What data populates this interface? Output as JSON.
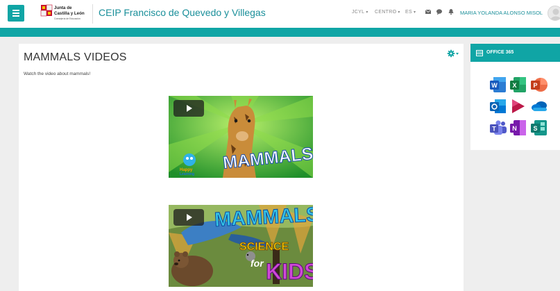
{
  "header": {
    "site_title": "CEIP Francisco de Quevedo y Villegas",
    "logo_line1": "Junta de",
    "logo_line2": "Castilla y León",
    "logo_line3": "Consejería de Educación",
    "nav": [
      {
        "label": "JCYL",
        "caret": "▾"
      },
      {
        "label": "CENTRO",
        "caret": "▾"
      },
      {
        "label": "ES",
        "caret": "▾"
      }
    ],
    "username": "MARIA YOLANDA ALONSO MISOL"
  },
  "main": {
    "title": "MAMMALS VIDEOS",
    "description": "Watch the video about mammals!",
    "videos": [
      {
        "thumb_text": "MAMMALS",
        "brand_line1": "Happy",
        "brand_line2": "Learning"
      },
      {
        "thumb_line1": "MAMMALS",
        "thumb_line2": "SCIENCE",
        "thumb_line3": "for",
        "thumb_line4": "KIDS"
      }
    ]
  },
  "sidebar_block": {
    "title": "OFFICE 365",
    "apps": [
      "Word",
      "Excel",
      "PowerPoint",
      "Outlook",
      "Stream",
      "OneDrive",
      "Teams",
      "OneNote",
      "Sway"
    ]
  },
  "colors": {
    "accent": "#10a5a5"
  }
}
